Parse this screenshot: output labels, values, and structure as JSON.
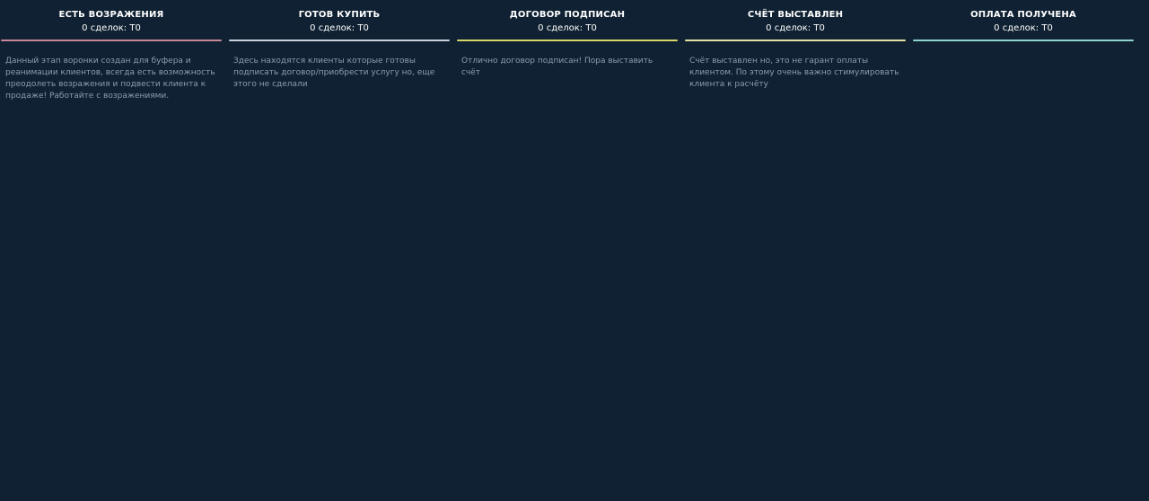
{
  "columns": [
    {
      "title": "ЕСТЬ ВОЗРАЖЕНИЯ",
      "count": "0 сделок: Т0",
      "accent": "#c9879c",
      "description": "Данный этап воронки создан для буфера и реанимации клиентов, всегда есть возможность преодолеть возражения и подвести клиента к продаже! Работайте с возражениями."
    },
    {
      "title": "ГОТОВ КУПИТЬ",
      "count": "0 сделок: Т0",
      "accent": "#c9d2da",
      "description": "Здесь находятся клиенты которые готовы подписать договор/приобрести услугу но, еще этого не сделали"
    },
    {
      "title": "ДОГОВОР ПОДПИСАН",
      "count": "0 сделок: Т0",
      "accent": "#d6d56a",
      "description": "Отлично договор подписан! Пора выставить счёт"
    },
    {
      "title": "СЧЁТ ВЫСТАВЛЕН",
      "count": "0 сделок: Т0",
      "accent": "#e5e1a2",
      "description": "Счёт выставлен но, это не гарант оплаты клиентом. По этому очень важно стимулировать клиента к расчёту"
    },
    {
      "title": "ОПЛАТА ПОЛУЧЕНА",
      "count": "0 сделок: Т0",
      "accent": "#8fd3cf",
      "description": ""
    }
  ]
}
